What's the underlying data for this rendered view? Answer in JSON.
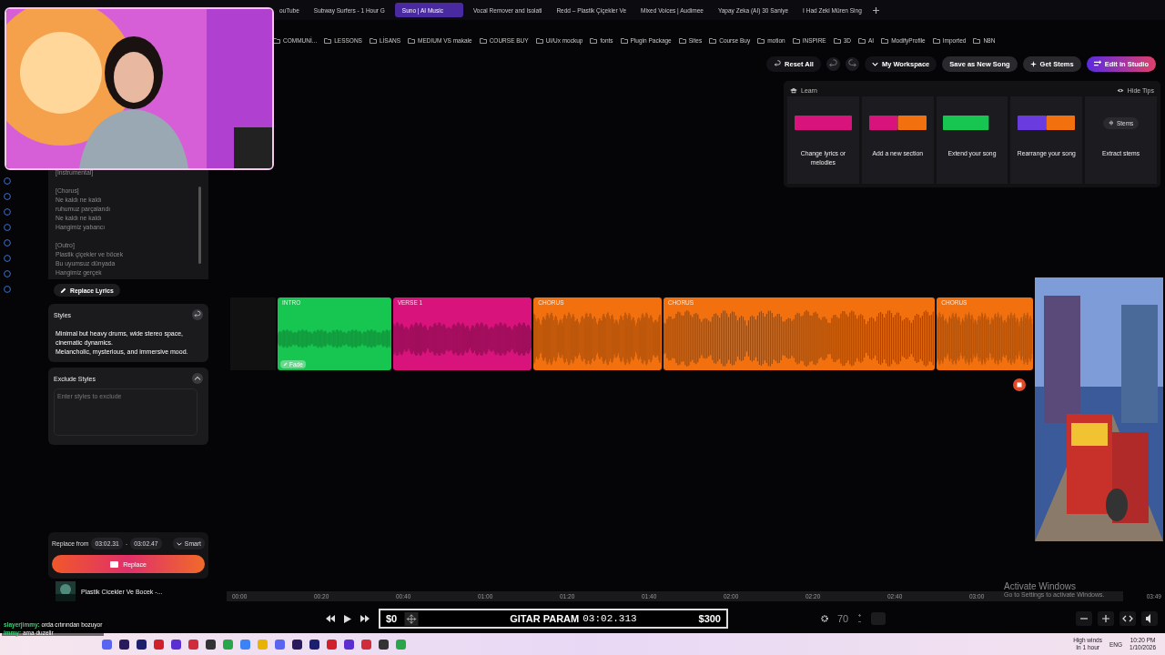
{
  "browser": {
    "tabs": [
      {
        "title": "ouTube",
        "selected": false
      },
      {
        "title": "Subway Surfers - 1 Hour G",
        "selected": false
      },
      {
        "title": "Suno | AI Music",
        "selected": true
      },
      {
        "title": "Vocal Remover and Isolati",
        "selected": false
      },
      {
        "title": "Redd – Plastik Çiçekler Ve",
        "selected": false
      },
      {
        "title": "Mixed Voices | Audimee",
        "selected": false
      },
      {
        "title": "Yapay Zeka (AI) 30 Saniye",
        "selected": false
      },
      {
        "title": "I Had Zeki Müren Sing",
        "selected": false
      }
    ],
    "bookmarks": [
      "COMMUNİ...",
      "LESSONS",
      "LİSANS",
      "MEDIUM VS makale",
      "COURSE BUY",
      "UI/Ux mockup",
      "fonts",
      "Plugin Package",
      "Sites",
      "Course Buy",
      "motion",
      "INSPIRE",
      "3D",
      "AI",
      "ModifyProfile",
      "Imported",
      "N8N"
    ]
  },
  "toolbar": {
    "reset": "Reset All",
    "workspace": "My Workspace",
    "save": "Save as New Song",
    "stems": "Get Stems",
    "studio": "Edit in Studio"
  },
  "learn": {
    "title": "Learn",
    "hide": "Hide Tips",
    "cards": [
      {
        "kind": "replace",
        "caption": "Change lyrics or melodies"
      },
      {
        "kind": "add",
        "caption": "Add a new section"
      },
      {
        "kind": "extend",
        "caption": "Extend your song"
      },
      {
        "kind": "rearrange",
        "caption": "Rearrange your song"
      },
      {
        "kind": "stems",
        "caption": "Extract stems",
        "button": "Stems"
      }
    ]
  },
  "lyrics": {
    "stanzas": [
      [
        "[Instrumental]"
      ],
      [
        "[Chorus]",
        "Ne kaldı ne kaldı",
        "ruhumuz parçalandı",
        "Ne kaldı ne kaldı",
        "Hangimiz yabancı"
      ],
      [
        "[Outro]",
        "Plastik çiçekler ve böcek",
        "Bu uyumsuz dünyada",
        "Hangimiz gerçek"
      ]
    ],
    "button": "Replace Lyrics"
  },
  "styles": {
    "label": "Styles",
    "text": "Minimal but heavy drums, wide stereo space, cinematic dynamics.\nMelancholic, mysterious, and immersive mood."
  },
  "exclude": {
    "label": "Exclude Styles",
    "placeholder": "Enter styles to exclude"
  },
  "replace": {
    "label": "Replace from",
    "from": "03:02.31",
    "dash": "-",
    "to": "03:02.47",
    "mode": "Smart",
    "button": "Replace"
  },
  "now_playing": {
    "title": "Plastik Cicekler Ve Bocek -..."
  },
  "clips": [
    {
      "label": "INTRO",
      "color": "#17c650",
      "badge": "Fade"
    },
    {
      "label": "VERSE 1",
      "color": "#d9137c"
    },
    {
      "label": "CHORUS",
      "color": "#f3700e"
    },
    {
      "label": "CHORUS",
      "color": "#f3700e"
    },
    {
      "label": "CHORUS",
      "color": "#f3700e"
    }
  ],
  "ruler": [
    "00:00",
    "00:20",
    "00:40",
    "01:00",
    "01:20",
    "01:40",
    "02:00",
    "02:20",
    "02:40",
    "03:00",
    "03:49"
  ],
  "transport": {
    "left_amount": "$0",
    "title": "GITAR PARAM",
    "time": "03:02.313",
    "right_amount": "$300",
    "zoom": "70"
  },
  "activation": {
    "title": "Activate Windows",
    "text": "Go to Settings to activate Windows."
  },
  "chat": [
    {
      "user": "slayerjimmy:",
      "text": "orda cıtırından bozuyor"
    },
    {
      "user": "immy:",
      "text": "ama duzelir"
    }
  ],
  "taskbar": {
    "weather": "High winds",
    "weather_note": "In 1 hour",
    "language": "ENG",
    "time": "10:20 PM",
    "date": "1/10/2026"
  }
}
